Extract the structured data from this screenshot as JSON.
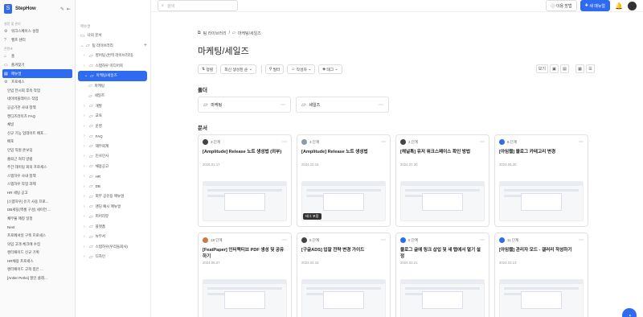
{
  "brand": {
    "name": "StepHow"
  },
  "search": {
    "placeholder": "검색"
  },
  "header": {
    "guide": "이용 방법",
    "new_manual": "새 매뉴얼"
  },
  "sidebar": {
    "section1": "설정 및 관리",
    "top_items": [
      {
        "icon": "⚙",
        "label": "워크스페이스 설정"
      },
      {
        "icon": "?",
        "label": "헬프 센터"
      }
    ],
    "section2": "콘텐츠",
    "nav": [
      {
        "icon": "⌂",
        "label": "홈"
      },
      {
        "icon": "▭",
        "label": "즐겨찾기"
      },
      {
        "icon": "▤",
        "label": "매뉴얼"
      },
      {
        "icon": "⚙",
        "label": "프로세스"
      }
    ],
    "sub": [
      "인입 전시회 후속 작업",
      "네이버플레이스 작업",
      "공공기관 사내 정책",
      "캔디즈라이즈 FAQ",
      "채널",
      "신규 기능 업데이트 배포...",
      "배포",
      "인입 직원 온보딩",
      "출퇴근 처리 방법",
      "주간 데이팅 회의 프로세스",
      "스텝하우 사내 정책",
      "스텝하우 작업 과제",
      "HR 세팅 공고",
      "[스텝하우] 유기 사용 프로...",
      "DB세팅(엑셀 구성) 세이언 ...",
      "채무불 매칭 일정",
      "Next",
      "프로페셔널 구축 프로세스",
      "의입 고객 체크에 수집",
      "렌터패이드 신규 기획",
      "HR채용 프로세스",
      "렌터패이드 고객 접은 ...",
      "[Antler Perks] 할인 클레..."
    ]
  },
  "tree": {
    "mine": "나의 문서",
    "section": "매뉴얼",
    "team": "팀 라이브러리",
    "items": [
      {
        "label": "영어팀 (번역 라이브러리)",
        "level": 1
      },
      {
        "label": "스텝하우 미디어북",
        "level": 1
      },
      {
        "label": "마케팅/세일즈",
        "level": 1,
        "selected": true
      },
      {
        "label": "마케팅",
        "level": 2
      },
      {
        "label": "세일즈",
        "level": 2
      },
      {
        "label": "개발",
        "level": 1
      },
      {
        "label": "교육",
        "level": 1
      },
      {
        "label": "운영",
        "level": 1
      },
      {
        "label": "FAQ",
        "level": 1
      },
      {
        "label": "재무회계",
        "level": 1
      },
      {
        "label": "인사인사",
        "level": 1
      },
      {
        "label": "채용공고",
        "level": 1
      },
      {
        "label": "HR",
        "level": 1
      },
      {
        "label": "DB",
        "level": 1
      },
      {
        "label": "외부 공유용 매뉴얼",
        "level": 1
      },
      {
        "label": "랜딩 예시 매뉴얼",
        "level": 1
      },
      {
        "label": "피어리뷰",
        "level": 1
      },
      {
        "label": "플랫폼",
        "level": 1
      },
      {
        "label": "뉴무서",
        "level": 1
      },
      {
        "label": "스텝하우(우리들회사)",
        "level": 1
      },
      {
        "label": "디자인",
        "level": 1
      }
    ]
  },
  "breadcrumb": {
    "root": "팀 라이브러리",
    "sep": "/",
    "current": "마케팅/세일즈"
  },
  "page": {
    "title": "마케팅/세일즈"
  },
  "viewtools": {
    "label": "보기"
  },
  "filters": {
    "sort_label": "정렬",
    "sort_value": "최신 생성된 순",
    "filter": "필터",
    "author": "작성자",
    "tag": "태그"
  },
  "folders_section": "폴더",
  "folders": [
    {
      "label": "마케팅"
    },
    {
      "label": "세일즈"
    }
  ],
  "docs_section": "문서",
  "docs": [
    {
      "steps": "3 단계",
      "title": "[Amplitude] Release 노트 생성법 (외부)",
      "date": "2025.01.17",
      "avatar": "#444"
    },
    {
      "steps": "3 단계",
      "title": "[Amplitude] Release 노트 생성법",
      "date": "2024.10.16",
      "avatar": "#8a9aa8",
      "tag": "태그 포함"
    },
    {
      "steps": "2 단계",
      "title": "[채널톡] 유저 워크스페이스 확인 방법",
      "date": "2024.07.30",
      "avatar": "#444"
    },
    {
      "steps": "8 단계",
      "title": "[아임웹] 블로그 카테고리 변경",
      "date": "2024.06.25",
      "avatar": "#2f6bf0"
    },
    {
      "steps": "18 단계",
      "title": "[FeatPaper] 인터랙티브 PDF 생성 및 공유하기",
      "date": "2024.06.07",
      "avatar": "#c87a4a"
    },
    {
      "steps": "5 단계",
      "title": "[구글ADS] 입찰 전략 변경 가이드",
      "date": "2024.04.15",
      "avatar": "#444"
    },
    {
      "steps": "5 단계",
      "title": "블로그 글에 링크 삽입 및 새 탭에서 열기 설정",
      "date": "2024.03.21",
      "avatar": "#2f6bf0"
    },
    {
      "steps": "11 단계",
      "title": "[아임웹] 관리자 모드 - 갤러리 작성하기",
      "date": "2024.03.13",
      "avatar": "#2f6bf0"
    }
  ]
}
